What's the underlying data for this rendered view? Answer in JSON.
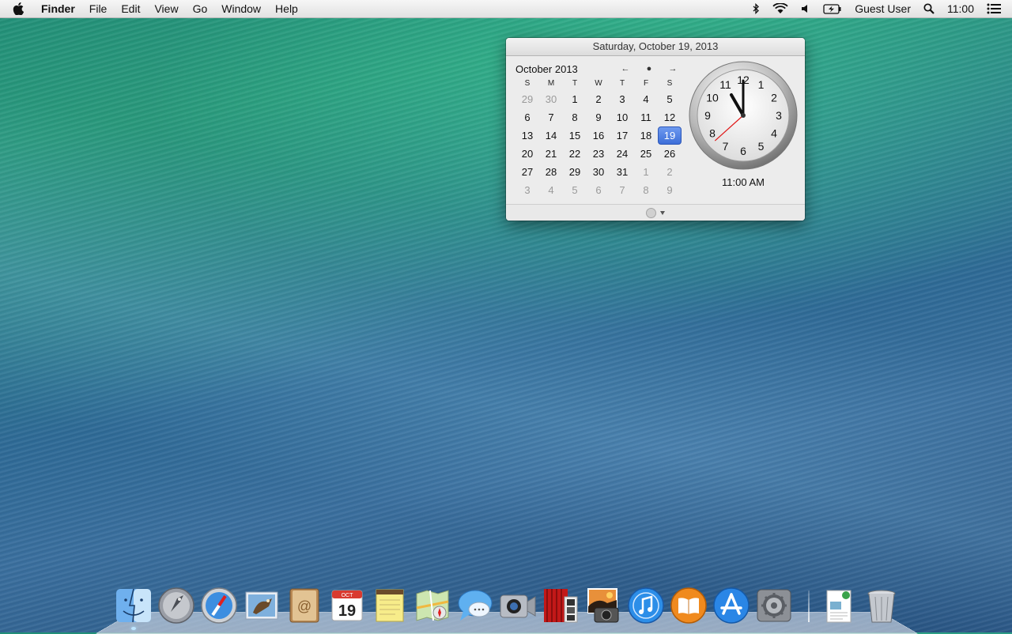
{
  "menubar": {
    "apple_glyph": "",
    "app_name": "Finder",
    "menus": [
      "File",
      "Edit",
      "View",
      "Go",
      "Window",
      "Help"
    ],
    "user": "Guest User",
    "clock": "11:00"
  },
  "popover": {
    "header_date": "Saturday, October 19, 2013",
    "month_label": "October 2013",
    "nav": [
      "←",
      "●",
      "→"
    ],
    "weekdays": [
      "S",
      "M",
      "T",
      "W",
      "T",
      "F",
      "S"
    ],
    "weeks": [
      [
        {
          "d": "29",
          "dim": true
        },
        {
          "d": "30",
          "dim": true
        },
        {
          "d": "1"
        },
        {
          "d": "2"
        },
        {
          "d": "3"
        },
        {
          "d": "4"
        },
        {
          "d": "5"
        }
      ],
      [
        {
          "d": "6"
        },
        {
          "d": "7"
        },
        {
          "d": "8"
        },
        {
          "d": "9"
        },
        {
          "d": "10"
        },
        {
          "d": "11"
        },
        {
          "d": "12"
        }
      ],
      [
        {
          "d": "13"
        },
        {
          "d": "14"
        },
        {
          "d": "15"
        },
        {
          "d": "16"
        },
        {
          "d": "17"
        },
        {
          "d": "18"
        },
        {
          "d": "19",
          "sel": true
        }
      ],
      [
        {
          "d": "20"
        },
        {
          "d": "21"
        },
        {
          "d": "22"
        },
        {
          "d": "23"
        },
        {
          "d": "24"
        },
        {
          "d": "25"
        },
        {
          "d": "26"
        }
      ],
      [
        {
          "d": "27"
        },
        {
          "d": "28"
        },
        {
          "d": "29"
        },
        {
          "d": "30"
        },
        {
          "d": "31"
        },
        {
          "d": "1",
          "dim": true
        },
        {
          "d": "2",
          "dim": true
        }
      ],
      [
        {
          "d": "3",
          "dim": true
        },
        {
          "d": "4",
          "dim": true
        },
        {
          "d": "5",
          "dim": true
        },
        {
          "d": "6",
          "dim": true
        },
        {
          "d": "7",
          "dim": true
        },
        {
          "d": "8",
          "dim": true
        },
        {
          "d": "9",
          "dim": true
        }
      ]
    ],
    "clock_numbers": [
      "12",
      "1",
      "2",
      "3",
      "4",
      "5",
      "6",
      "7",
      "8",
      "9",
      "10",
      "11"
    ],
    "clock_hour": 11,
    "clock_minute": 0,
    "clock_second": 38,
    "time_text": "11:00 AM"
  },
  "dock": {
    "calendar_month": "OCT",
    "calendar_day": "19",
    "apps": [
      "finder",
      "launchpad",
      "safari",
      "mail",
      "contacts",
      "calendar",
      "notes",
      "maps",
      "messages",
      "facetime",
      "photo-booth",
      "iphoto",
      "itunes",
      "ibooks",
      "app-store",
      "system-preferences"
    ],
    "running": [
      "finder"
    ]
  },
  "colors": {
    "selection": "#3d6ed8",
    "menubar": "#ececec"
  }
}
